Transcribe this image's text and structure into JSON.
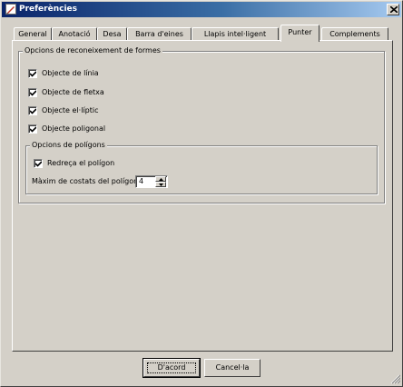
{
  "window": {
    "title": "Preferències",
    "icon": "preferences-app-icon",
    "close_icon": "close-icon"
  },
  "tabs": [
    {
      "label": "General",
      "active": false
    },
    {
      "label": "Anotació",
      "active": false
    },
    {
      "label": "Desa",
      "active": false
    },
    {
      "label": "Barra d'eines",
      "active": false
    },
    {
      "label": "Llapis intel·ligent",
      "active": false
    },
    {
      "label": "Punter",
      "active": true
    },
    {
      "label": "Complements",
      "active": false
    }
  ],
  "shape_recognition": {
    "title": "Opcions de reconeixement de formes",
    "items": [
      {
        "label": "Objecte de línia",
        "checked": true
      },
      {
        "label": "Objecte de fletxa",
        "checked": true
      },
      {
        "label": "Objecte el·líptic",
        "checked": true
      },
      {
        "label": "Objecte poligonal",
        "checked": true
      }
    ],
    "polygon_options": {
      "title": "Opcions de polígons",
      "straighten": {
        "label": "Redreça el polígon",
        "checked": true
      },
      "max_sides": {
        "label": "Màxim de costats del polígon",
        "value": "4"
      }
    }
  },
  "buttons": {
    "ok": "D'acord",
    "cancel": "Cancel·la"
  }
}
